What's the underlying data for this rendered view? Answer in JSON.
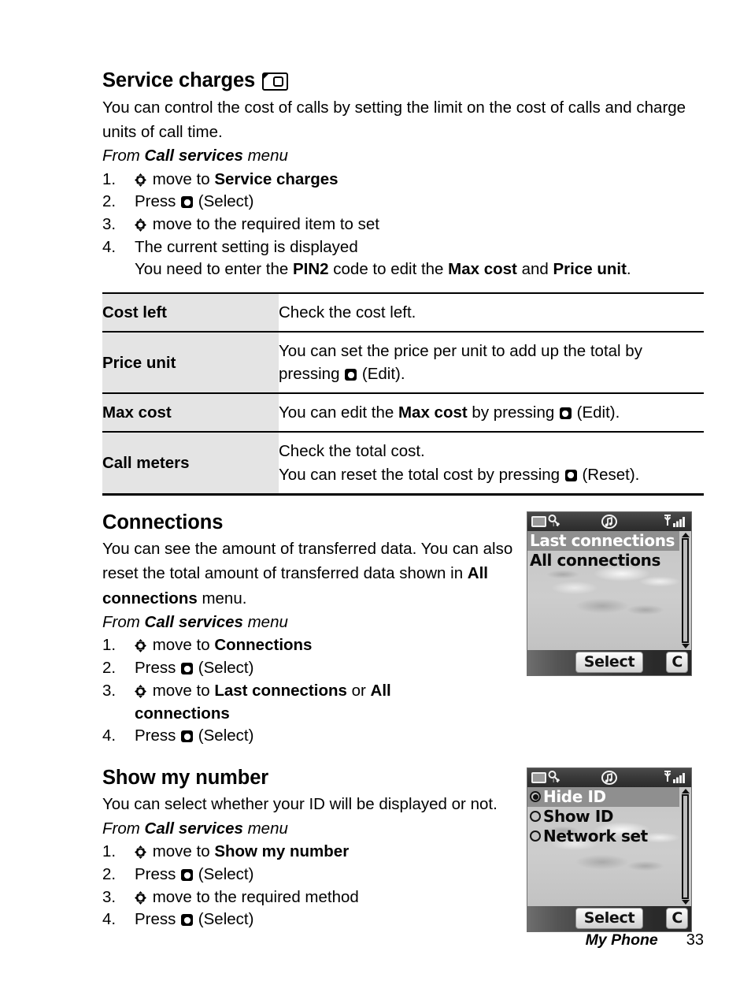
{
  "page": {
    "footer_title": "My Phone",
    "page_number": "33"
  },
  "sections": [
    {
      "heading": "Service charges",
      "heading_icon": "sim-card-icon",
      "intro": "You can control the cost of calls by setting the limit on the cost of calls and charge units of call time.",
      "from_prefix": "From ",
      "from_bold": "Call services",
      "from_suffix": " menu",
      "steps": [
        {
          "num": "1.",
          "icon": "nav-key-icon",
          "pre": " move to ",
          "bold": "Service charges",
          "post": ""
        },
        {
          "num": "2.",
          "icon": "select-key-icon",
          "pre": "Press ",
          "bold": "",
          "post": " (Select)"
        },
        {
          "num": "3.",
          "icon": "nav-key-icon",
          "pre": " move to the required item to set",
          "bold": "",
          "post": ""
        },
        {
          "num": "4.",
          "icon": "",
          "pre": "The current setting is displayed",
          "bold": "",
          "post": ""
        }
      ],
      "note": {
        "p1": "You need to enter the ",
        "b1": "PIN2",
        "p2": " code to edit the ",
        "b2": "Max cost",
        "p3": " and ",
        "b3": "Price unit",
        "p4": "."
      }
    }
  ],
  "table": {
    "rows": [
      {
        "key": "Cost left",
        "lines": [
          {
            "pre": "Check the cost left.",
            "bold": "",
            "mid": "",
            "icon": "",
            "post": ""
          }
        ]
      },
      {
        "key": "Price unit",
        "lines": [
          {
            "pre": "You can set the price per unit to add up the total by",
            "bold": "",
            "mid": "",
            "icon": "",
            "post": ""
          },
          {
            "pre": "pressing ",
            "bold": "",
            "mid": "",
            "icon": "select-key-icon",
            "post": " (Edit)."
          }
        ]
      },
      {
        "key": "Max cost",
        "lines": [
          {
            "pre": "You can edit the ",
            "bold": "Max cost",
            "mid": " by pressing ",
            "icon": "select-key-icon",
            "post": " (Edit)."
          }
        ]
      },
      {
        "key": "Call meters",
        "lines": [
          {
            "pre": "Check the total cost.",
            "bold": "",
            "mid": "",
            "icon": "",
            "post": ""
          },
          {
            "pre": "You can reset the total cost by pressing ",
            "bold": "",
            "mid": "",
            "icon": "select-key-icon",
            "post": " (Reset)."
          }
        ]
      }
    ]
  },
  "connections": {
    "heading": "Connections",
    "intro_p1": "You can see the amount of transferred data. You can also reset the total amount of transferred data shown in ",
    "intro_b1": "All connections",
    "intro_p2": " menu.",
    "from_prefix": "From ",
    "from_bold": "Call services",
    "from_suffix": " menu",
    "steps": [
      {
        "num": "1.",
        "icon": "nav-key-icon",
        "pre": " move to ",
        "bold": "Connections",
        "post": ""
      },
      {
        "num": "2.",
        "icon": "select-key-icon",
        "pre": "Press ",
        "bold": "",
        "post": " (Select)"
      },
      {
        "num": "3.",
        "icon": "nav-key-icon",
        "pre": " move to ",
        "bold": "Last connections",
        "mid": " or ",
        "bold2": "All",
        "wrap": "connections"
      },
      {
        "num": "4.",
        "icon": "select-key-icon",
        "pre": "Press ",
        "bold": "",
        "post": " (Select)"
      }
    ],
    "phone": {
      "status_icons": [
        "battery-icon",
        "key-icon",
        "music-note-icon",
        "signal-bars-icon"
      ],
      "menu_items": [
        {
          "label": "Last connections",
          "selected": true
        },
        {
          "label": "All connections",
          "selected": false
        }
      ],
      "softkey_left": "Select",
      "softkey_right": "C"
    }
  },
  "show_my_number": {
    "heading": "Show my number",
    "intro": "You can select whether your ID will be displayed or not.",
    "from_prefix": "From ",
    "from_bold": "Call services",
    "from_suffix": " menu",
    "steps": [
      {
        "num": "1.",
        "icon": "nav-key-icon",
        "pre": " move to ",
        "bold": "Show my number",
        "post": ""
      },
      {
        "num": "2.",
        "icon": "select-key-icon",
        "pre": "Press ",
        "bold": "",
        "post": " (Select)"
      },
      {
        "num": "3.",
        "icon": "nav-key-icon",
        "pre": " move to the required method",
        "bold": "",
        "post": ""
      },
      {
        "num": "4.",
        "icon": "select-key-icon",
        "pre": "Press ",
        "bold": "",
        "post": " (Select)"
      }
    ],
    "phone": {
      "status_icons": [
        "battery-icon",
        "key-icon",
        "music-note-icon",
        "signal-bars-icon"
      ],
      "menu_items": [
        {
          "label": "Hide ID",
          "selected": true,
          "radio": true
        },
        {
          "label": "Show ID",
          "selected": false,
          "radio": true
        },
        {
          "label": "Network set",
          "selected": false,
          "radio": true
        }
      ],
      "softkey_left": "Select",
      "softkey_right": "C"
    }
  }
}
